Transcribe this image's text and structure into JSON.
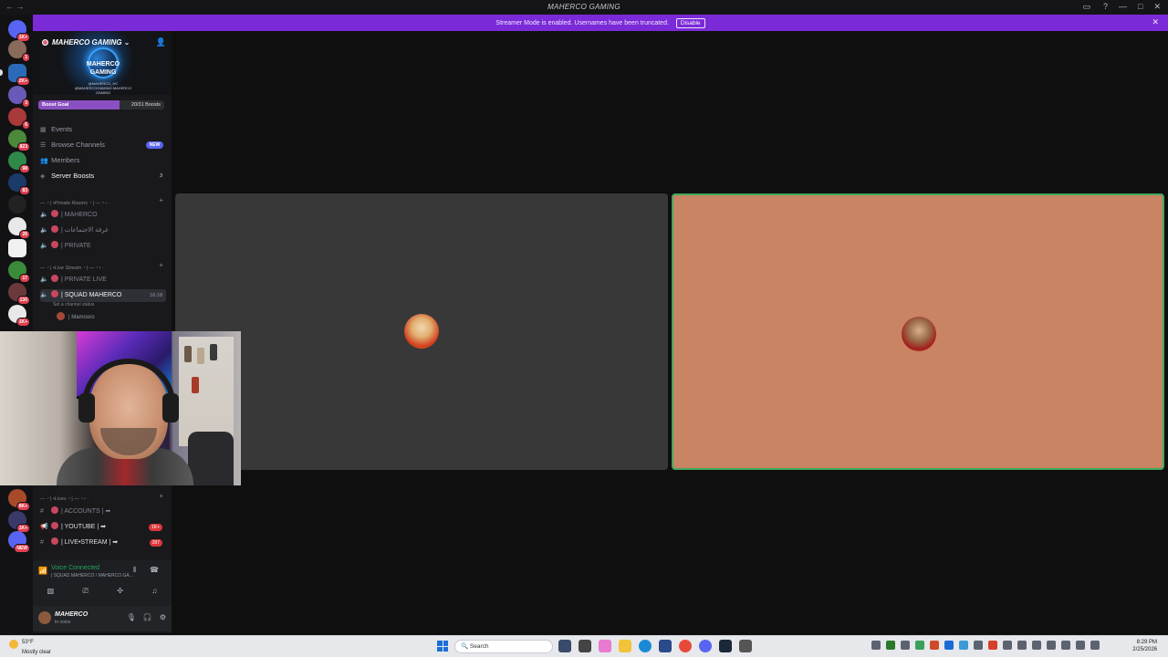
{
  "window": {
    "title": "MAHERCO GAMING"
  },
  "banner": {
    "message": "Streamer Mode is enabled. Usernames have been truncated.",
    "disable_label": "Disable"
  },
  "rail": {
    "badges": [
      "1K+",
      "1",
      "2K+",
      "3",
      "6",
      "823",
      "98",
      "83",
      "26",
      "17",
      "130",
      "1K+",
      "8K+",
      "1K+",
      "NEW"
    ]
  },
  "server": {
    "name": "MAHERCO GAMING",
    "logo_text": "MAHERCO GAMING",
    "banner_small_text": "@MAHERCO_HC @MAHERCOGAMING MAHERCO GAMING",
    "boost_label": "Boost Goal",
    "boost_count": "20/31 Boosts",
    "boost_progress": 0.645
  },
  "nav": {
    "events": "Events",
    "browse_channels": "Browse Channels",
    "new_badge": "NEW",
    "members": "Members",
    "server_boosts": "Server Boosts",
    "server_boosts_count": "3"
  },
  "categories": {
    "private_rooms": "—・| •Private Rooms・| —・‹ ·",
    "live_stream": "—・| •Live Stream・| —・‹ ·",
    "lives": "—・| •Lives・| —・‹ ·"
  },
  "channels": {
    "maherco": "| MAHERCO",
    "meetings": "| غرفة الاجتماعات",
    "private": "| PRIVATE",
    "private_live": "| PRIVATE LIVE",
    "squad": "| SQUAD MAHERCO",
    "squad_time": "16:18",
    "squad_status": "Set a channel status",
    "member_1": "| Mamooro",
    "accounts": "| ACCOUNTS | ➡",
    "youtube": "| YOUTUBE | ➡",
    "youtube_badge": "1K+",
    "livestream": "| LIVE•STREAM | ➡",
    "livestream_badge": "287"
  },
  "voice": {
    "title": "Voice Connected",
    "subtitle": "| SQUAD MAHERCO / MAHERCO GA..."
  },
  "user": {
    "name": "MAHERCO",
    "status": "In voice"
  },
  "taskbar": {
    "temp": "53°F",
    "weather": "Mostly clear",
    "search_placeholder": "Search",
    "time": "8:29 PM",
    "date": "2/25/2026"
  },
  "colors": {
    "banner": "#7b2ad8",
    "speaking_border": "#3fa95c",
    "tile_left": "#383838",
    "tile_right": "#c98463",
    "voice_green": "#23a55a"
  }
}
